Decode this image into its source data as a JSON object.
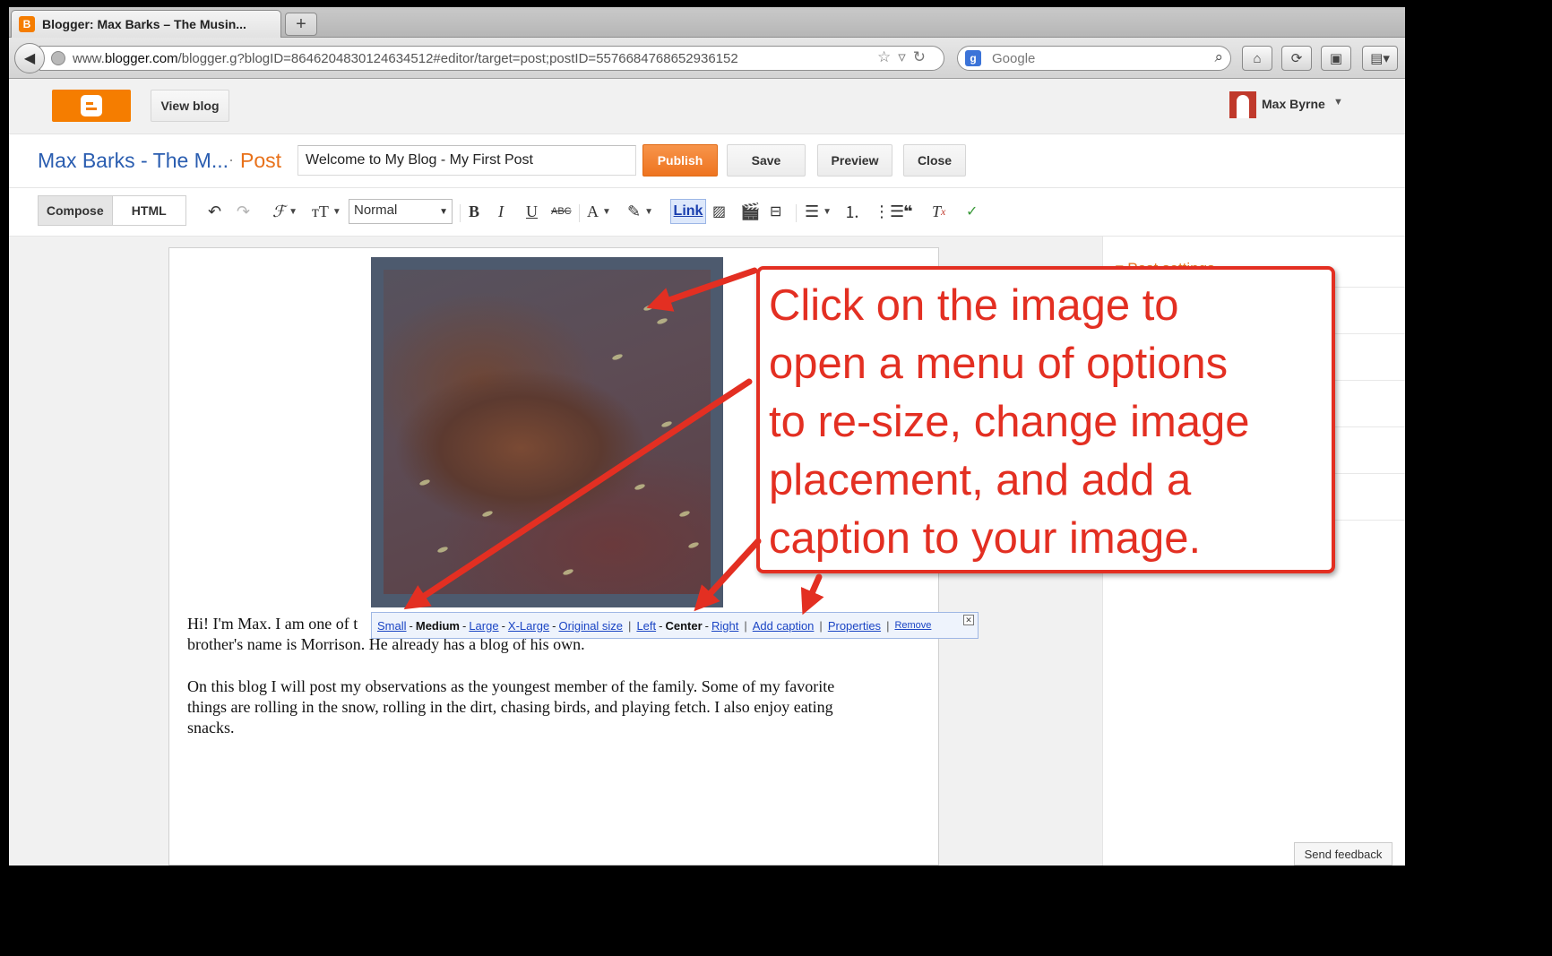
{
  "browser": {
    "tab_title": "Blogger: Max Barks – The Musin...",
    "new_tab_label": "+",
    "url_prefix": "www.",
    "url_domain": "blogger.com",
    "url_path": "/blogger.g?blogID=8646204830124634512#editor/target=post;postID=5576684768652936152",
    "search_engine": "Google"
  },
  "header": {
    "view_blog_label": "View blog",
    "user_name": "Max Byrne"
  },
  "post": {
    "blog_title": "Max Barks - The M...",
    "separator": "·",
    "section_label": "Post",
    "title_value": "Welcome to My Blog - My First Post",
    "publish_label": "Publish",
    "save_label": "Save",
    "preview_label": "Preview",
    "close_label": "Close"
  },
  "toolbar": {
    "compose_label": "Compose",
    "html_label": "HTML",
    "font_size_value": "Normal",
    "link_label": "Link"
  },
  "editor": {
    "para1_line1": "Hi! I'm Max. I am one of t",
    "para1_line2": "brother's name is Morrison. He already has a blog of his own.",
    "para2_line1": "On this blog I will post my observations as the youngest member of the family. Some of my favorite",
    "para2_line2": "things are rolling in the snow, rolling in the dirt, chasing birds, and playing fetch. I also enjoy eating",
    "para2_line3": "snacks."
  },
  "image_menu": {
    "small": "Small",
    "medium": "Medium",
    "large": "Large",
    "xlarge": "X-Large",
    "original": "Original size",
    "left": "Left",
    "center": "Center",
    "right": "Right",
    "add_caption": "Add caption",
    "properties": "Properties",
    "remove": "Remove"
  },
  "side_panel": {
    "post_settings": "▾ Post settings",
    "send_feedback": "Send feedback"
  },
  "annotation": {
    "lines": [
      "Click on the image to",
      "open a menu of options",
      "to re-size, change image",
      "placement, and add a",
      "caption to your image."
    ]
  },
  "colors": {
    "blogger_orange": "#f57d00",
    "title_blue": "#2a5db0",
    "annotation_red": "#e32f22"
  }
}
